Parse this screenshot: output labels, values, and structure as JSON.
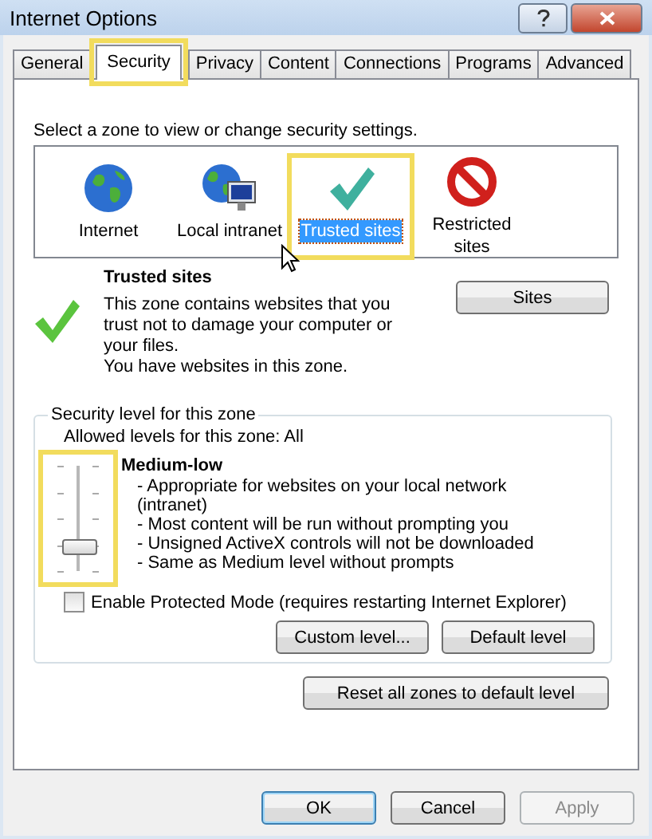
{
  "window": {
    "title": "Internet Options"
  },
  "tabs": [
    {
      "label": "General",
      "selected": false,
      "highlighted": false
    },
    {
      "label": "Security",
      "selected": true,
      "highlighted": true
    },
    {
      "label": "Privacy",
      "selected": false,
      "highlighted": false
    },
    {
      "label": "Content",
      "selected": false,
      "highlighted": false
    },
    {
      "label": "Connections",
      "selected": false,
      "highlighted": false
    },
    {
      "label": "Programs",
      "selected": false,
      "highlighted": false
    },
    {
      "label": "Advanced",
      "selected": false,
      "highlighted": false
    }
  ],
  "zone_prompt": "Select a zone to view or change security settings.",
  "zones": [
    {
      "kind": "internet",
      "label": "Internet",
      "selected": false,
      "highlighted": false
    },
    {
      "kind": "intranet",
      "label": "Local intranet",
      "selected": false,
      "highlighted": false
    },
    {
      "kind": "trusted",
      "label": "Trusted sites",
      "selected": true,
      "highlighted": true
    },
    {
      "kind": "restricted",
      "label": "Restricted sites",
      "selected": false,
      "highlighted": false
    }
  ],
  "zone_info": {
    "title": "Trusted sites",
    "description": [
      "This zone contains websites that you trust not to damage your computer or your files.",
      "You have websites in this zone."
    ],
    "button": "Sites"
  },
  "security_level": {
    "legend": "Security level for this zone",
    "allowed": "Allowed levels for this zone: All",
    "slider": {
      "level": 0.25,
      "highlighted": true
    },
    "level_name": "Medium-low",
    "bullets": [
      "- Appropriate for websites on your local network (intranet)",
      "- Most content will be run without prompting you",
      "- Unsigned ActiveX controls will not be downloaded",
      "- Same as Medium level without prompts"
    ],
    "protected_mode": {
      "label": "Enable Protected Mode (requires restarting Internet Explorer)",
      "checked": false
    },
    "buttons": [
      "Custom level...",
      "Default level"
    ]
  },
  "reset_button": "Reset all zones to default level",
  "footer_buttons": [
    {
      "label": "OK",
      "default": true,
      "disabled": false
    },
    {
      "label": "Cancel",
      "default": false,
      "disabled": false
    },
    {
      "label": "Apply",
      "default": false,
      "disabled": true
    }
  ]
}
